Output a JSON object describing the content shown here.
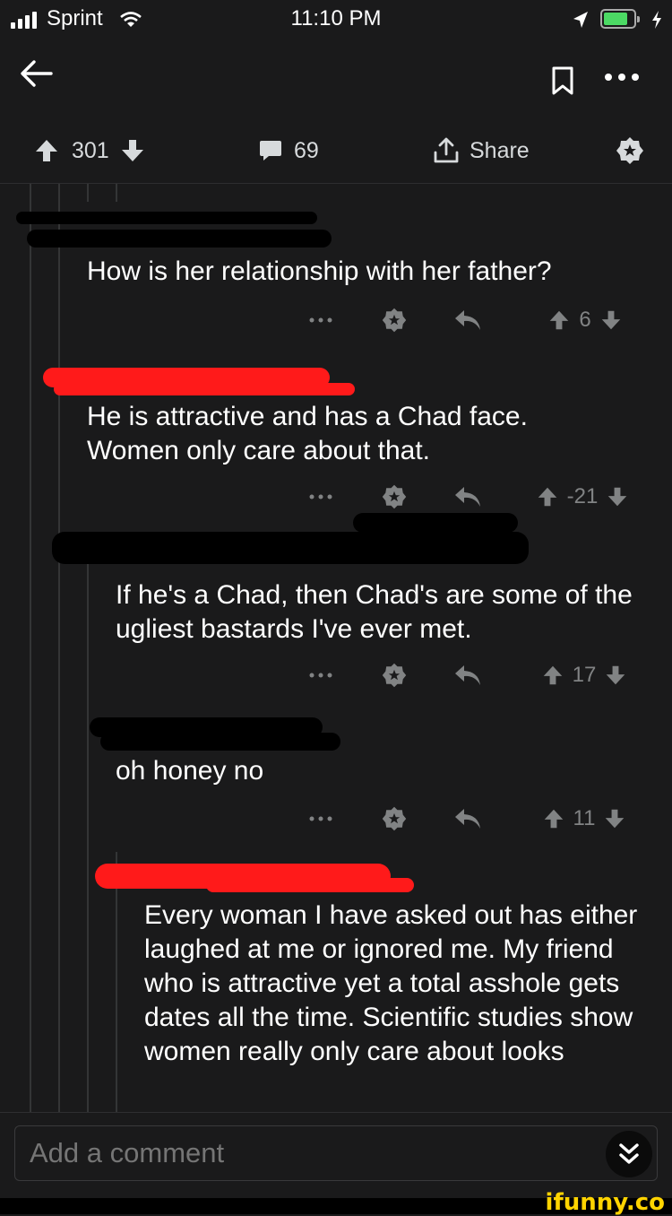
{
  "status_bar": {
    "carrier": "Sprint",
    "time": "11:10 PM"
  },
  "post_bar": {
    "upvotes": "301",
    "comments": "69",
    "share_label": "Share"
  },
  "comments": [
    {
      "text": "How is her relationship with her father?",
      "score": "6"
    },
    {
      "text": "He is attractive and has a Chad face. Women only care about that.",
      "score": "-21"
    },
    {
      "text": "If he's a Chad, then Chad's are some of the ugliest bastards I've ever met.",
      "score": "17"
    },
    {
      "text": "oh honey no",
      "score": "11"
    },
    {
      "text": "Every woman I have asked out has either laughed at me or ignored me. My friend who is attractive yet a total asshole gets dates all the time. Scientific studies show women really only care about looks"
    }
  ],
  "comment_input": {
    "placeholder": "Add a comment"
  },
  "watermark": "ifunny.co",
  "colors": {
    "background": "#1a1a1b",
    "text": "#ffffff",
    "muted": "#818384",
    "redaction_red": "#ff1a1a",
    "redaction_black": "#000000",
    "battery": "#4cd964"
  }
}
